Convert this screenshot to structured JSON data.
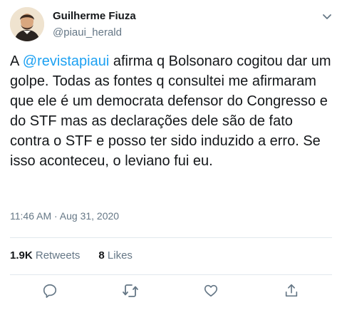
{
  "author": {
    "display_name": "Guilherme Fiuza",
    "handle": "@piaui_herald"
  },
  "tweet": {
    "text_prefix": "A ",
    "mention": "@revistapiaui",
    "text_rest": " afirma q Bolsonaro cogitou dar um golpe. Todas as fontes q consultei me afirmaram que ele é um democrata defensor do Congresso e do STF mas as declarações dele são de fato contra o STF e posso ter sido induzido a erro. Se isso aconteceu, o leviano fui eu.",
    "timestamp": "11:46 AM · Aug 31, 2020"
  },
  "stats": {
    "retweets_count": "1.9K",
    "retweets_label": "Retweets",
    "likes_count": "8",
    "likes_label": "Likes"
  },
  "icons": {
    "menu": "chevron-down-icon",
    "reply": "reply-icon",
    "retweet": "retweet-icon",
    "like": "heart-icon",
    "share": "share-icon"
  },
  "colors": {
    "text": "#14171a",
    "secondary": "#657786",
    "link": "#1da1f2",
    "divider": "#e1e8ed"
  }
}
